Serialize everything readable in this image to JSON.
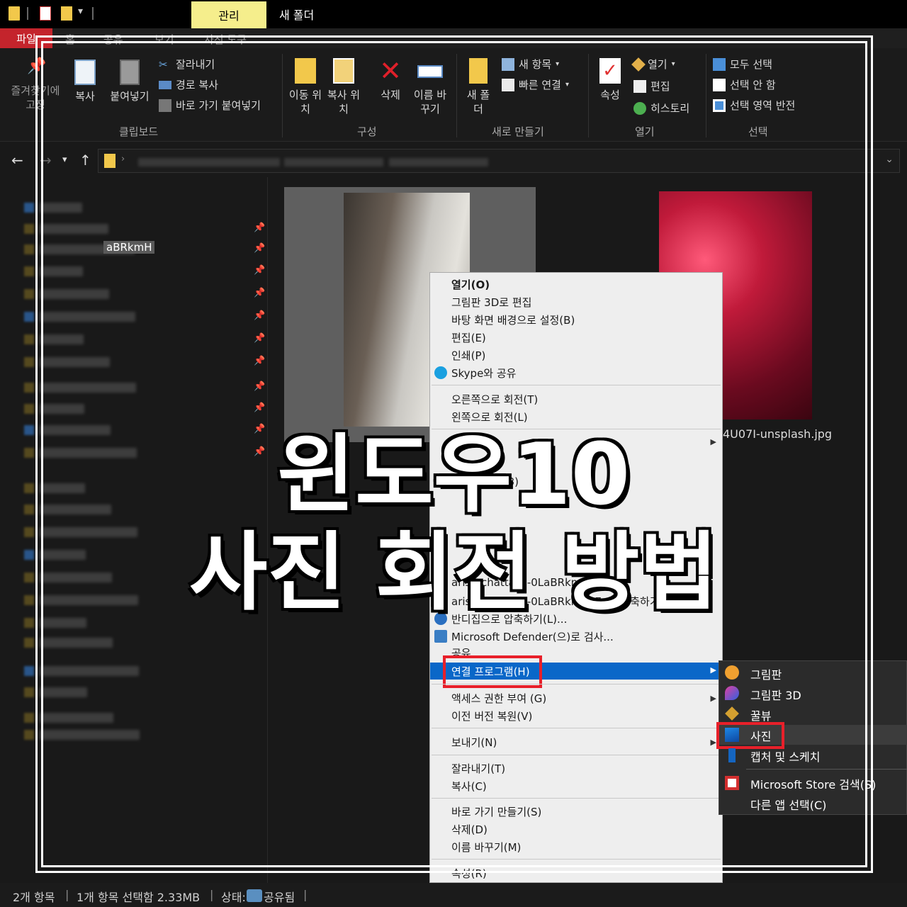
{
  "titlebar": {
    "context_tab": "관리",
    "window_title": "새 폴더"
  },
  "ribbon_tabs": [
    "파일",
    "홈",
    "공유",
    "보기",
    "사진 도구"
  ],
  "ribbon": {
    "clipboard": {
      "pin": "즐겨찾기에 고정",
      "copy": "복사",
      "paste": "붙여넣기",
      "cut": "잘라내기",
      "copy_path": "경로 복사",
      "paste_shortcut": "바로 가기 붙여넣기",
      "group": "클립보드"
    },
    "organize": {
      "move_to": "이동 위치",
      "copy_to": "복사 위치",
      "delete": "삭제",
      "rename": "이름 바꾸기",
      "group": "구성"
    },
    "new": {
      "new_folder": "새 폴더",
      "new_item": "새 항목",
      "easy_access": "빠른 연결",
      "group": "새로 만들기"
    },
    "open": {
      "properties": "속성",
      "open": "열기",
      "edit": "편집",
      "history": "히스토리",
      "group": "열기"
    },
    "select": {
      "select_all": "모두 선택",
      "select_none": "선택 안 함",
      "invert": "선택 영역 반전",
      "group": "선택"
    }
  },
  "files": {
    "file1_label": "aBRkmH",
    "file2_label": "4U07I-unsplash.jpg"
  },
  "context_menu": {
    "open": "열기(O)",
    "paint3d_edit": "그림판 3D로 편집",
    "set_wallpaper": "바탕 화면 배경으로 설정(B)",
    "edit": "편집(E)",
    "print": "인쇄(P)",
    "skype_share": "Skype와 공유",
    "rotate_right": "오른쪽으로 회전(T)",
    "rotate_left": "왼쪽으로 회전(L)",
    "honeyview": "꿀뷰로 보기(3)",
    "compress_7z_1": "arisa-chattasa-0LaBRkm...",
    "compress_7z": "arisa-chattasa-0LaBRkm....7z로 압축하기(7)",
    "bandizip": "반디집으로 압축하기(L)...",
    "defender": "Microsoft Defender(으)로 검사...",
    "share": "공유",
    "open_with": "연결 프로그램(H)",
    "give_access": "액세스 권한 부여 (G)",
    "restore": "이전 버전 복원(V)",
    "send_to": "보내기(N)",
    "cut": "잘라내기(T)",
    "copy": "복사(C)",
    "create_shortcut": "바로 가기 만들기(S)",
    "delete": "삭제(D)",
    "rename": "이름 바꾸기(M)",
    "properties": "속성(R)"
  },
  "submenu": {
    "paint": "그림판",
    "paint3d": "그림판 3D",
    "honeyview": "꿀뷰",
    "photos": "사진",
    "snip": "캡처 및 스케치",
    "store": "Microsoft Store 검색(S)",
    "other": "다른 앱 선택(C)"
  },
  "status": {
    "count": "2개 항목",
    "selected": "1개 항목 선택함 2.33MB",
    "state": "상태:",
    "shared": "공유됨"
  },
  "overlay": {
    "line1": "윈도우10",
    "line2": "사진 회전 방법"
  },
  "colors": {
    "accent_red": "#e8202a",
    "highlight_blue": "#0a67c8",
    "context_tab_yellow": "#f5ee8c"
  }
}
